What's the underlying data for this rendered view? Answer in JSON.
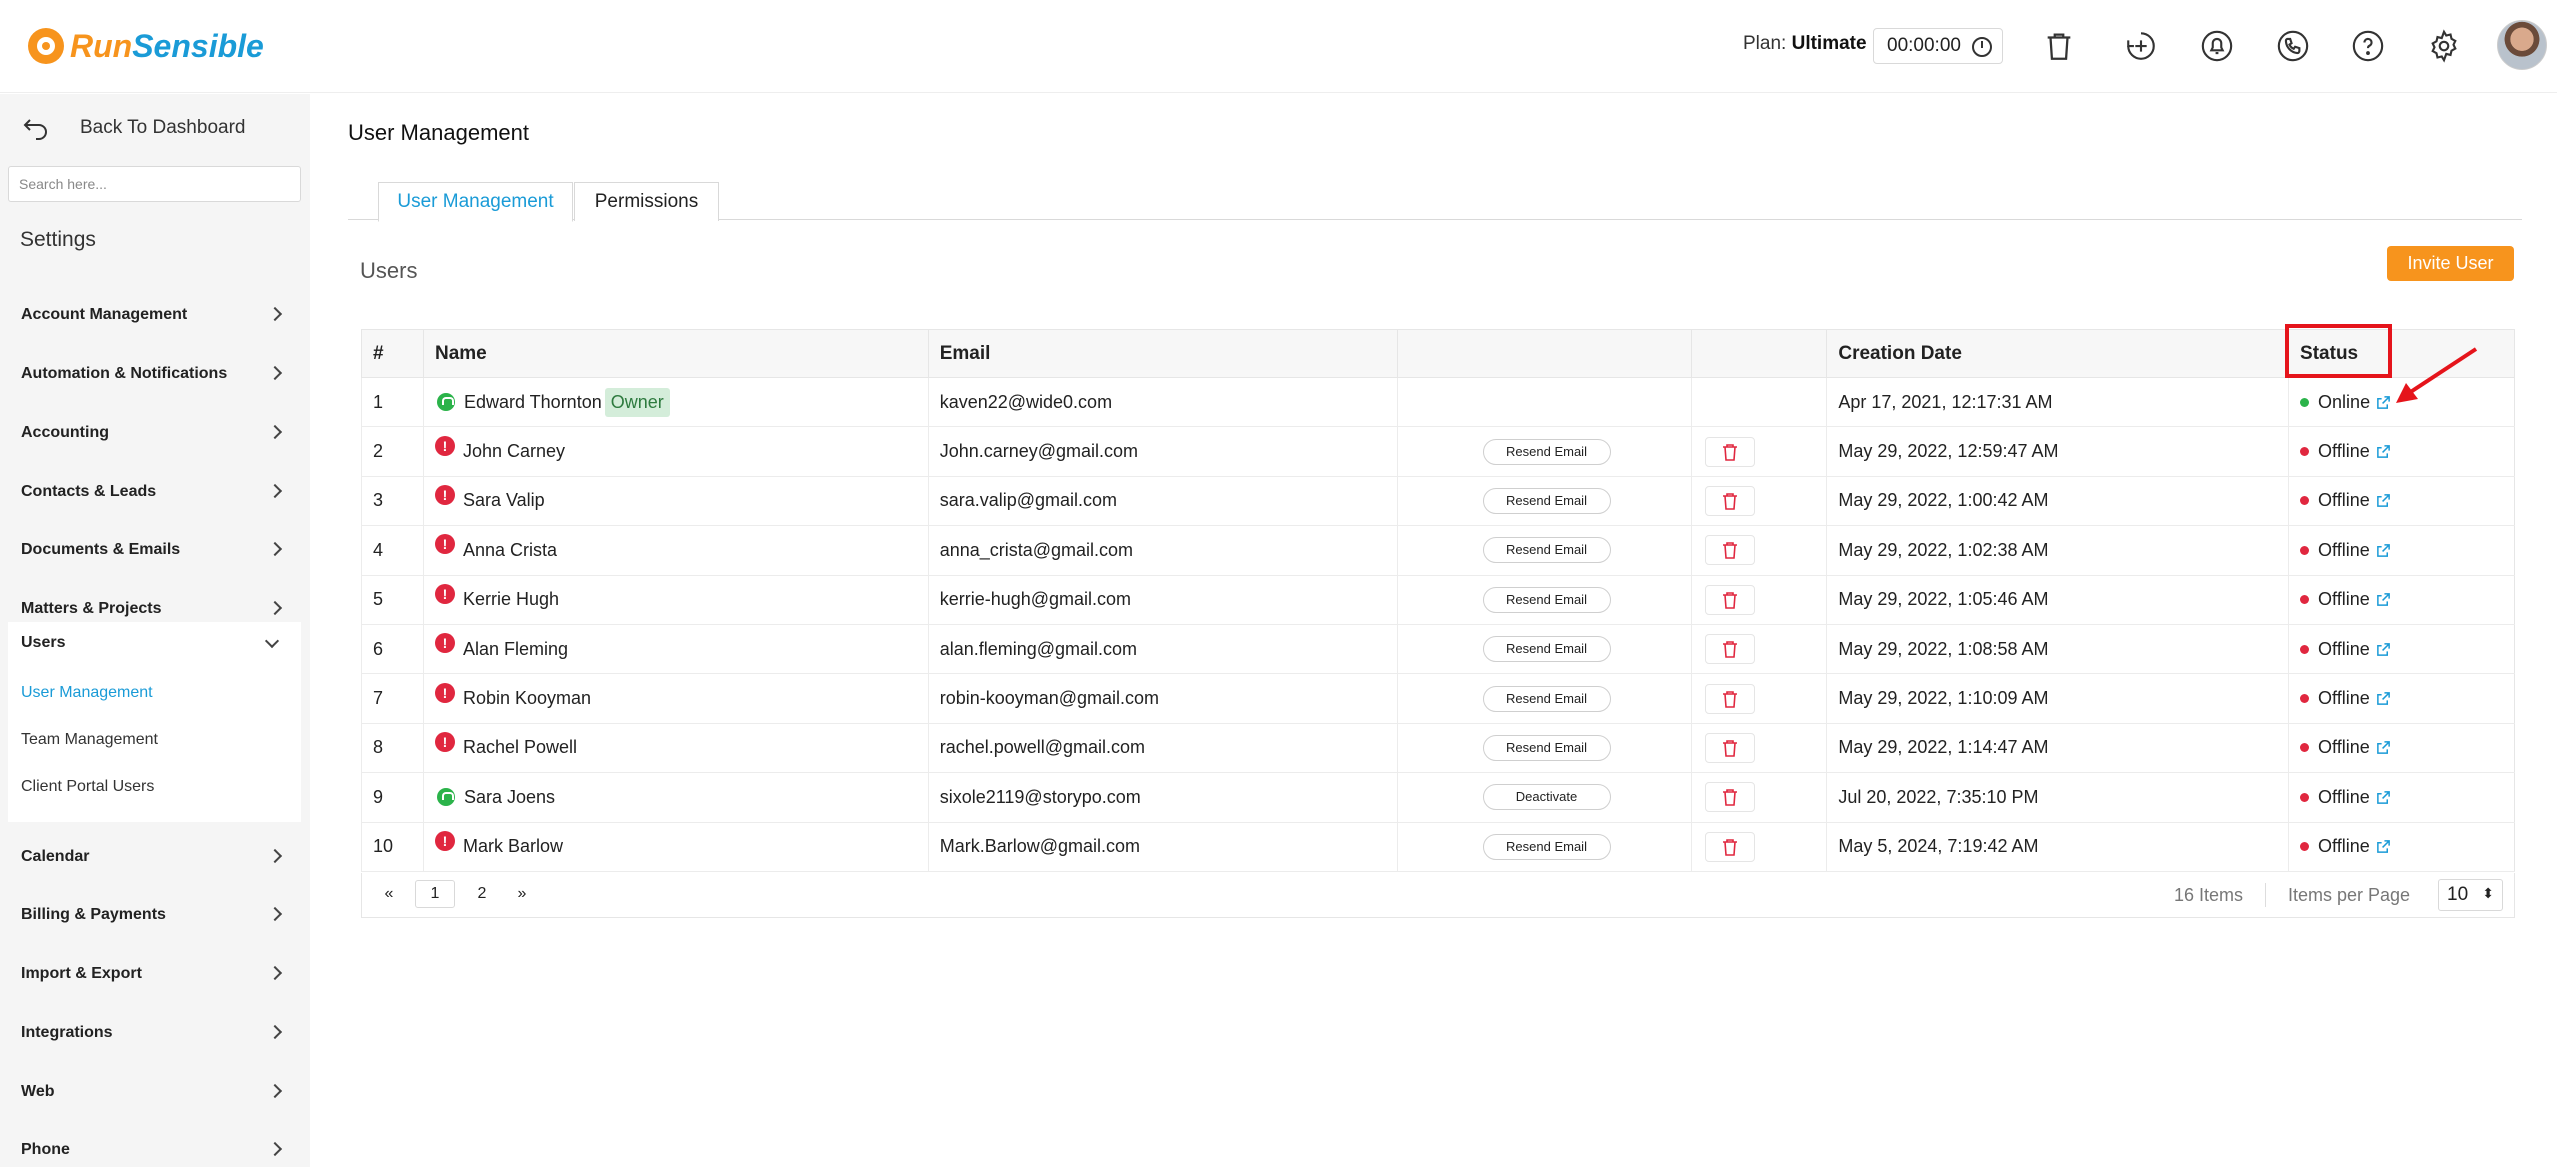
{
  "header": {
    "logo_run": "Run",
    "logo_sensible": "Sensible",
    "plan_label": "Plan:",
    "plan_value": "Ultimate",
    "timer": "00:00:00",
    "icons": [
      "trash-icon",
      "add-time-icon",
      "notification-bell-icon",
      "phone-icon",
      "help-icon",
      "gear-icon"
    ]
  },
  "sidebar": {
    "back": "Back To Dashboard",
    "search_placeholder": "Search here...",
    "settings_title": "Settings",
    "items": [
      "Account Management",
      "Automation & Notifications",
      "Accounting",
      "Contacts & Leads",
      "Documents & Emails",
      "Matters & Projects",
      "Users",
      "Calendar",
      "Billing & Payments",
      "Import & Export",
      "Integrations",
      "Web",
      "Phone"
    ],
    "users_sub": [
      "User Management",
      "Team Management",
      "Client Portal Users"
    ]
  },
  "main": {
    "title": "User Management",
    "tabs": [
      "User Management",
      "Permissions"
    ],
    "users_label": "Users",
    "invite_button": "Invite User",
    "columns": [
      "#",
      "Name",
      "Email",
      "",
      "",
      "Creation Date",
      "Status"
    ],
    "rows": [
      {
        "n": "1",
        "name": "Edward Thornton",
        "badge": "Owner",
        "icon": "ok",
        "email": "kaven22@wide0.com",
        "action": "",
        "delete": false,
        "created": "Apr 17, 2021, 12:17:31 AM",
        "status": "Online"
      },
      {
        "n": "2",
        "name": "John Carney",
        "badge": "",
        "icon": "err",
        "email": "John.carney@gmail.com",
        "action": "Resend Email",
        "delete": true,
        "created": "May 29, 2022, 12:59:47 AM",
        "status": "Offline"
      },
      {
        "n": "3",
        "name": "Sara Valip",
        "badge": "",
        "icon": "err",
        "email": "sara.valip@gmail.com",
        "action": "Resend Email",
        "delete": true,
        "created": "May 29, 2022, 1:00:42 AM",
        "status": "Offline"
      },
      {
        "n": "4",
        "name": "Anna Crista",
        "badge": "",
        "icon": "err",
        "email": "anna_crista@gmail.com",
        "action": "Resend Email",
        "delete": true,
        "created": "May 29, 2022, 1:02:38 AM",
        "status": "Offline"
      },
      {
        "n": "5",
        "name": "Kerrie Hugh",
        "badge": "",
        "icon": "err",
        "email": "kerrie-hugh@gmail.com",
        "action": "Resend Email",
        "delete": true,
        "created": "May 29, 2022, 1:05:46 AM",
        "status": "Offline"
      },
      {
        "n": "6",
        "name": "Alan Fleming",
        "badge": "",
        "icon": "err",
        "email": "alan.fleming@gmail.com",
        "action": "Resend Email",
        "delete": true,
        "created": "May 29, 2022, 1:08:58 AM",
        "status": "Offline"
      },
      {
        "n": "7",
        "name": "Robin Kooyman",
        "badge": "",
        "icon": "err",
        "email": "robin-kooyman@gmail.com",
        "action": "Resend Email",
        "delete": true,
        "created": "May 29, 2022, 1:10:09 AM",
        "status": "Offline"
      },
      {
        "n": "8",
        "name": "Rachel Powell",
        "badge": "",
        "icon": "err",
        "email": "rachel.powell@gmail.com",
        "action": "Resend Email",
        "delete": true,
        "created": "May 29, 2022, 1:14:47 AM",
        "status": "Offline"
      },
      {
        "n": "9",
        "name": "Sara Joens",
        "badge": "",
        "icon": "ok",
        "email": "sixole2119@storypo.com",
        "action": "Deactivate",
        "delete": true,
        "created": "Jul 20, 2022, 7:35:10 PM",
        "status": "Offline"
      },
      {
        "n": "10",
        "name": "Mark Barlow",
        "badge": "",
        "icon": "err",
        "email": "Mark.Barlow@gmail.com",
        "action": "Resend Email",
        "delete": true,
        "created": "May 5, 2024, 7:19:42 AM",
        "status": "Offline"
      }
    ],
    "pager": {
      "prev": "«",
      "pages": [
        "1",
        "2"
      ],
      "next": "»",
      "items_count": "16 Items",
      "items_per_page_label": "Items per Page",
      "items_per_page": "10"
    }
  },
  "colors": {
    "brand_orange": "#f7941d",
    "brand_blue": "#1a9bd7",
    "online": "#2bb34a",
    "offline": "#e0273f",
    "highlight": "#e5141b"
  }
}
